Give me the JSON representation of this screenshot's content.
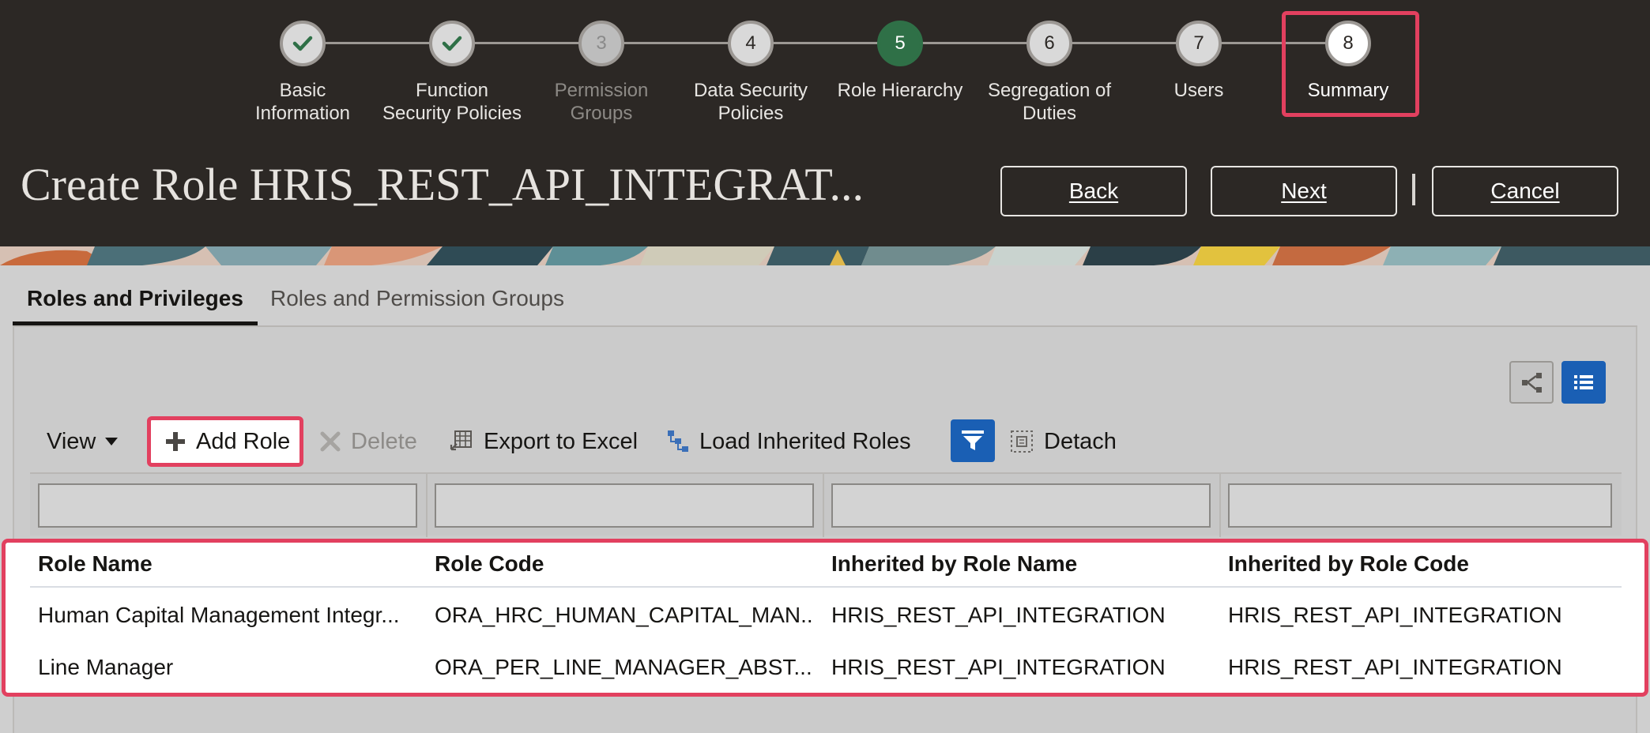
{
  "train": {
    "steps": [
      {
        "number": "",
        "label_lines": [
          "Basic",
          "Information"
        ],
        "state": "completed"
      },
      {
        "number": "",
        "label_lines": [
          "Function",
          "Security Policies"
        ],
        "state": "completed"
      },
      {
        "number": "3",
        "label_lines": [
          "Permission",
          "Groups"
        ],
        "state": "disabled"
      },
      {
        "number": "4",
        "label_lines": [
          "Data Security",
          "Policies"
        ],
        "state": "pending"
      },
      {
        "number": "5",
        "label_lines": [
          "Role Hierarchy",
          ""
        ],
        "state": "current"
      },
      {
        "number": "6",
        "label_lines": [
          "Segregation of",
          "Duties"
        ],
        "state": "pending"
      },
      {
        "number": "7",
        "label_lines": [
          "Users",
          ""
        ],
        "state": "pending"
      },
      {
        "number": "8",
        "label_lines": [
          "Summary",
          ""
        ],
        "state": "pending"
      }
    ]
  },
  "header": {
    "title": "Create Role HRIS_REST_API_INTEGRAT...",
    "back_label": "Back",
    "next_label": "Next",
    "cancel_label": "Cancel"
  },
  "tabs": [
    {
      "label": "Roles and Privileges",
      "active": true
    },
    {
      "label": "Roles and Permission Groups",
      "active": false
    }
  ],
  "toolbar": {
    "view_label": "View",
    "add_role_label": "Add Role",
    "delete_label": "Delete",
    "export_label": "Export to Excel",
    "load_inherited_label": "Load Inherited Roles",
    "detach_label": "Detach"
  },
  "table": {
    "columns": [
      "Role Name",
      "Role Code",
      "Inherited by Role Name",
      "Inherited by Role Code"
    ],
    "rows": [
      [
        "Human Capital Management Integr...",
        "ORA_HRC_HUMAN_CAPITAL_MAN...",
        "HRIS_REST_API_INTEGRATION",
        "HRIS_REST_API_INTEGRATION"
      ],
      [
        "Line Manager",
        "ORA_PER_LINE_MANAGER_ABST...",
        "HRIS_REST_API_INTEGRATION",
        "HRIS_REST_API_INTEGRATION"
      ]
    ]
  },
  "colors": {
    "header_bg": "#2c2825",
    "current_step": "#2f7047",
    "highlight": "#e2405f",
    "accent_blue": "#1a5fb4"
  }
}
